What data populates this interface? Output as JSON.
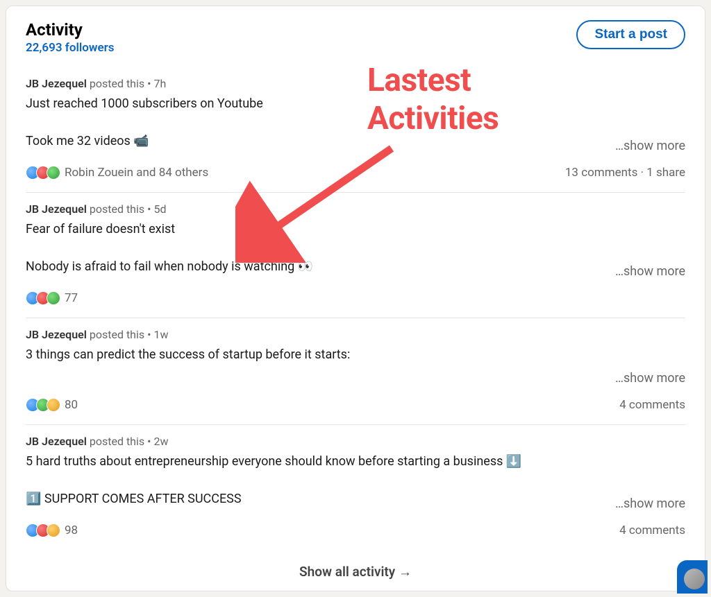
{
  "header": {
    "title": "Activity",
    "followers": "22,693 followers",
    "start_post": "Start a post"
  },
  "posts": [
    {
      "author": "JB Jezequel",
      "posted_label": "posted this",
      "time": "7h",
      "body_start": "Just reached 1000 subscribers on Youtube\n\nTook me 32 videos 📹",
      "show_more": "…show more",
      "reaction_types": [
        "like",
        "love",
        "cel"
      ],
      "reaction_text": "Robin Zouein and 84 others",
      "footer_stats": "13 comments · 1 share"
    },
    {
      "author": "JB Jezequel",
      "posted_label": "posted this",
      "time": "5d",
      "body_start": "Fear of failure doesn't exist\n\nNobody is afraid to fail when nobody is watching 👀",
      "show_more": "…show more",
      "reaction_types": [
        "like",
        "love",
        "cel"
      ],
      "reaction_text": "77",
      "footer_stats": ""
    },
    {
      "author": "JB Jezequel",
      "posted_label": "posted this",
      "time": "1w",
      "body_start": "3 things can predict the success of startup before it starts:\n\n",
      "show_more": "…show more",
      "reaction_types": [
        "like",
        "cel",
        "bulb"
      ],
      "reaction_text": "80",
      "footer_stats": "4 comments"
    },
    {
      "author": "JB Jezequel",
      "posted_label": "posted this",
      "time": "2w",
      "body_start": "5 hard truths about entrepreneurship everyone should know before starting a business ⬇️\n\n1️⃣ SUPPORT COMES AFTER SUCCESS",
      "show_more": "…show more",
      "reaction_types": [
        "like",
        "love",
        "bulb"
      ],
      "reaction_text": "98",
      "footer_stats": "4 comments"
    }
  ],
  "show_all": "Show all activity →",
  "annotation": "Lastest\nActivities"
}
